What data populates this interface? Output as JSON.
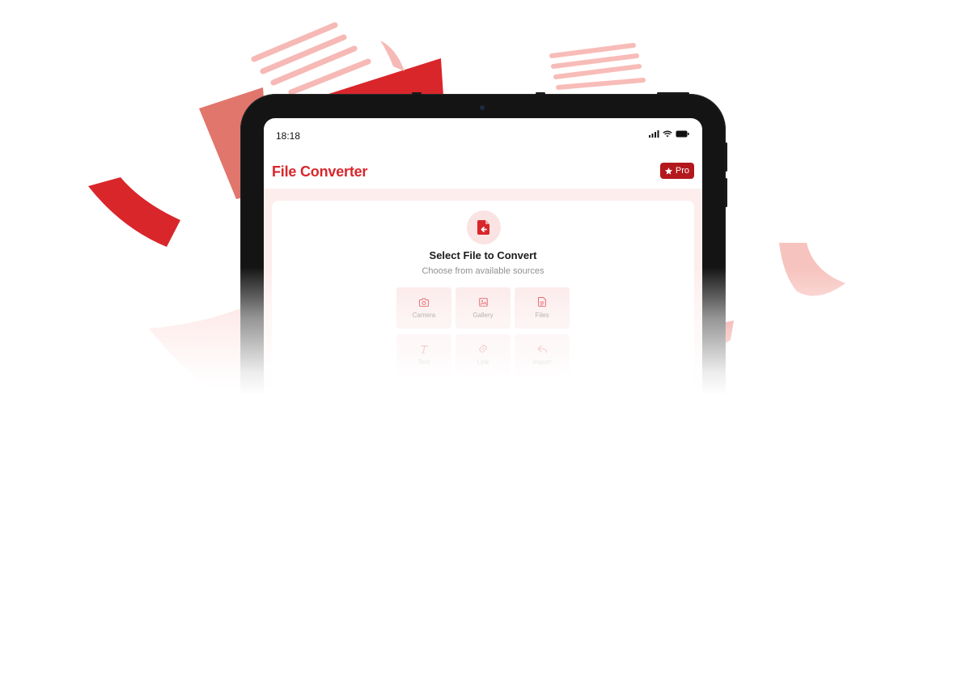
{
  "status_bar": {
    "time": "18:18",
    "icons": [
      "signal-icon",
      "wifi-icon",
      "battery-icon"
    ]
  },
  "app": {
    "title": "File Converter",
    "pro_label": "Pro"
  },
  "select_card": {
    "title": "Select File to Convert",
    "subtitle": "Choose from available sources",
    "icon": "file-import-icon"
  },
  "sources": [
    {
      "label": "Camera",
      "icon": "camera-icon"
    },
    {
      "label": "Gallery",
      "icon": "image-icon"
    },
    {
      "label": "Files",
      "icon": "document-icon"
    },
    {
      "label": "Text",
      "icon": "text-icon"
    },
    {
      "label": "Link",
      "icon": "link-icon"
    },
    {
      "label": "Import",
      "icon": "reply-icon"
    }
  ],
  "colors": {
    "accent": "#d9262b",
    "pro_bg": "#b3181d",
    "content_bg": "#fdeeed",
    "tile_bg": "#fbe6e6"
  }
}
